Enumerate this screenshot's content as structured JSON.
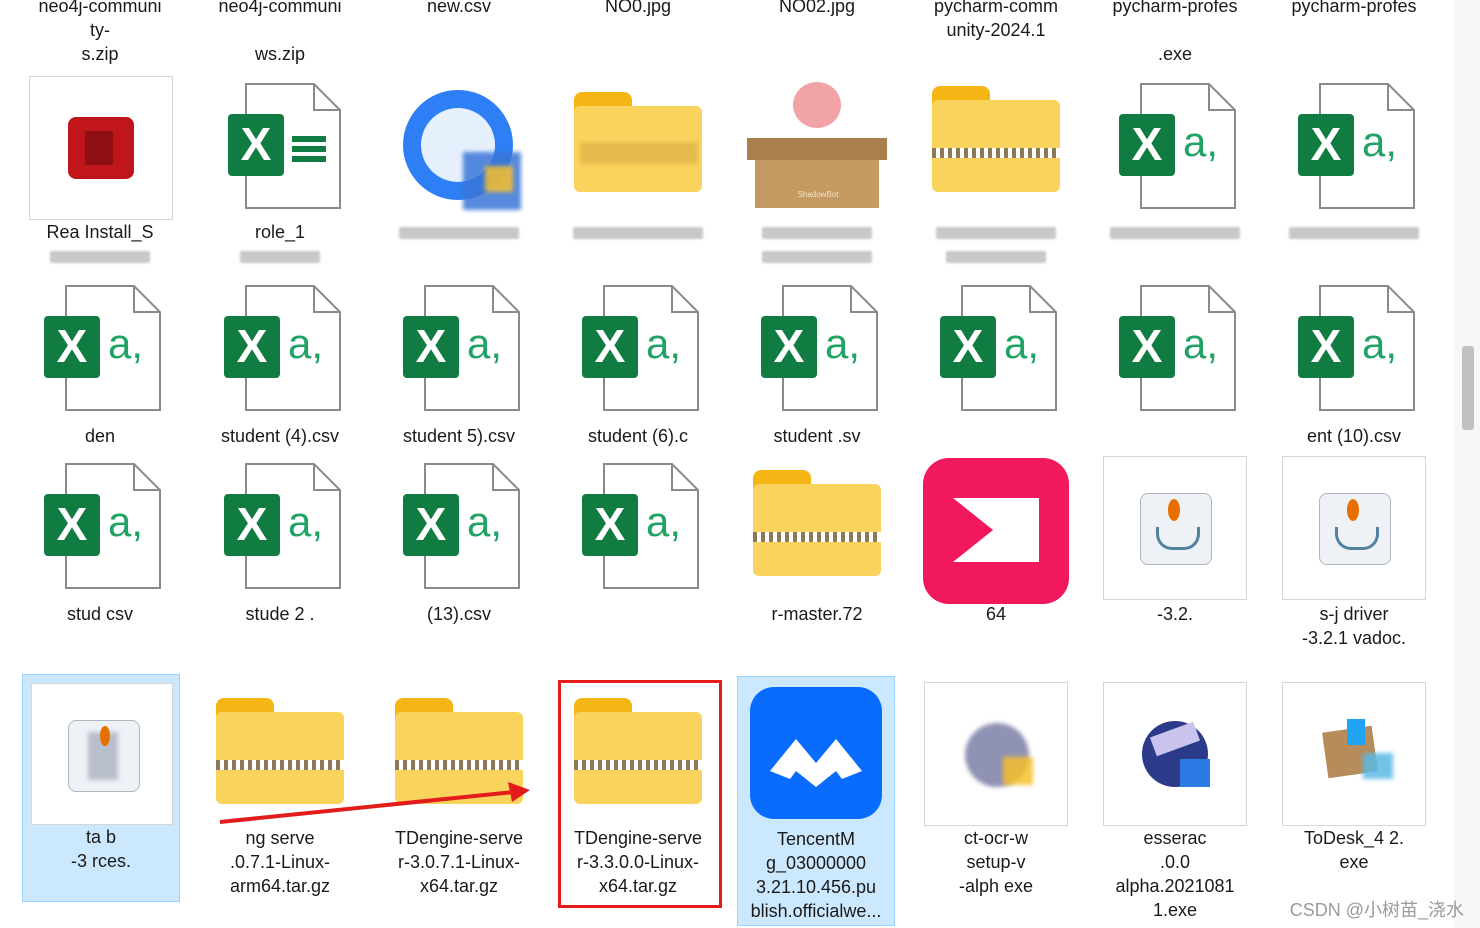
{
  "top_row": [
    {
      "label": "neo4j-communi\nty-",
      "extra": "s.zip"
    },
    {
      "label": "neo4j-communi",
      "extra": "ws.zip"
    },
    {
      "label": "new.csv",
      "extra": ""
    },
    {
      "label": "NO0.jpg",
      "extra": ""
    },
    {
      "label": "NO02.jpg",
      "extra": ""
    },
    {
      "label": "pycharm-comm\nunity-2024.1",
      "extra": ""
    },
    {
      "label": "pycharm-profes",
      "extra": ".exe"
    },
    {
      "label": "pycharm-profes",
      "extra": ""
    }
  ],
  "row1": [
    {
      "label": "Rea   Install_S",
      "icon": "pdf-installer-icon"
    },
    {
      "label": "role_1",
      "icon": "excel-icon"
    },
    {
      "label": "",
      "icon": "installer-icon"
    },
    {
      "label": "",
      "icon": "folder-icon"
    },
    {
      "label": "",
      "icon": "box-icon"
    },
    {
      "label": "",
      "icon": "zip-folder-icon"
    },
    {
      "label": "",
      "icon": "csv-excel-icon"
    },
    {
      "label": "",
      "icon": "csv-excel-icon"
    }
  ],
  "row2": [
    {
      "label": "  den  ",
      "icon": "csv-excel-icon"
    },
    {
      "label": "student (4).csv",
      "icon": "csv-excel-icon"
    },
    {
      "label": "student  5).csv",
      "icon": "csv-excel-icon"
    },
    {
      "label": "student (6).c",
      "icon": "csv-excel-icon"
    },
    {
      "label": "student    .sv",
      "icon": "csv-excel-icon"
    },
    {
      "label": "",
      "icon": "csv-excel-icon"
    },
    {
      "label": "",
      "icon": "csv-excel-icon"
    },
    {
      "label": "   ent (10).csv",
      "icon": "csv-excel-icon"
    }
  ],
  "row3": [
    {
      "label": "stud      csv",
      "icon": "csv-excel-icon"
    },
    {
      "label": "stude    2 .",
      "icon": "csv-excel-icon"
    },
    {
      "label": "(13).csv",
      "icon": "csv-excel-icon"
    },
    {
      "label": "",
      "icon": "csv-excel-icon"
    },
    {
      "label": "r-master.72",
      "icon": "zip-folder-icon"
    },
    {
      "label": "64",
      "icon": "media-player-icon"
    },
    {
      "label": "-3.2.",
      "icon": "java-icon"
    },
    {
      "label": "  s-j    driver\n-3.2.1    vadoc.",
      "icon": "java-icon"
    }
  ],
  "row4": [
    {
      "label": "ta     b\n-3      rces.",
      "icon": "java-icon",
      "selected": true
    },
    {
      "label": "  ng    serve\n  .0.7.1-Linux-\narm64.tar.gz",
      "icon": "zip-folder-icon"
    },
    {
      "label": "TDengine-serve\nr-3.0.7.1-Linux-\nx64.tar.gz",
      "icon": "zip-folder-icon"
    },
    {
      "label": "TDengine-serve\nr-3.3.0.0-Linux-\nx64.tar.gz",
      "icon": "zip-folder-icon"
    },
    {
      "label": "TencentM\ng_03000000\n3.21.10.456.pu\nblish.officialwe...",
      "icon": "tencent-meeting-icon",
      "selected": true
    },
    {
      "label": "     ct-ocr-w\n  setup-v\n-alph    exe",
      "icon": "ocr-installer-icon"
    },
    {
      "label": "esserac\n        .0.0\nalpha.2021081\n1.exe",
      "icon": "ocr-installer-icon"
    },
    {
      "label": "ToDesk_4    2.\nexe",
      "icon": "todesk-icon"
    }
  ],
  "watermark": "CSDN @小树苗_浇水",
  "colors": {
    "selection_bg": "#cce8ff",
    "selection_border": "#99d1ff",
    "annotation": "#e21b1b",
    "excel_green": "#107c41",
    "folder_yellow": "#f8c940"
  }
}
